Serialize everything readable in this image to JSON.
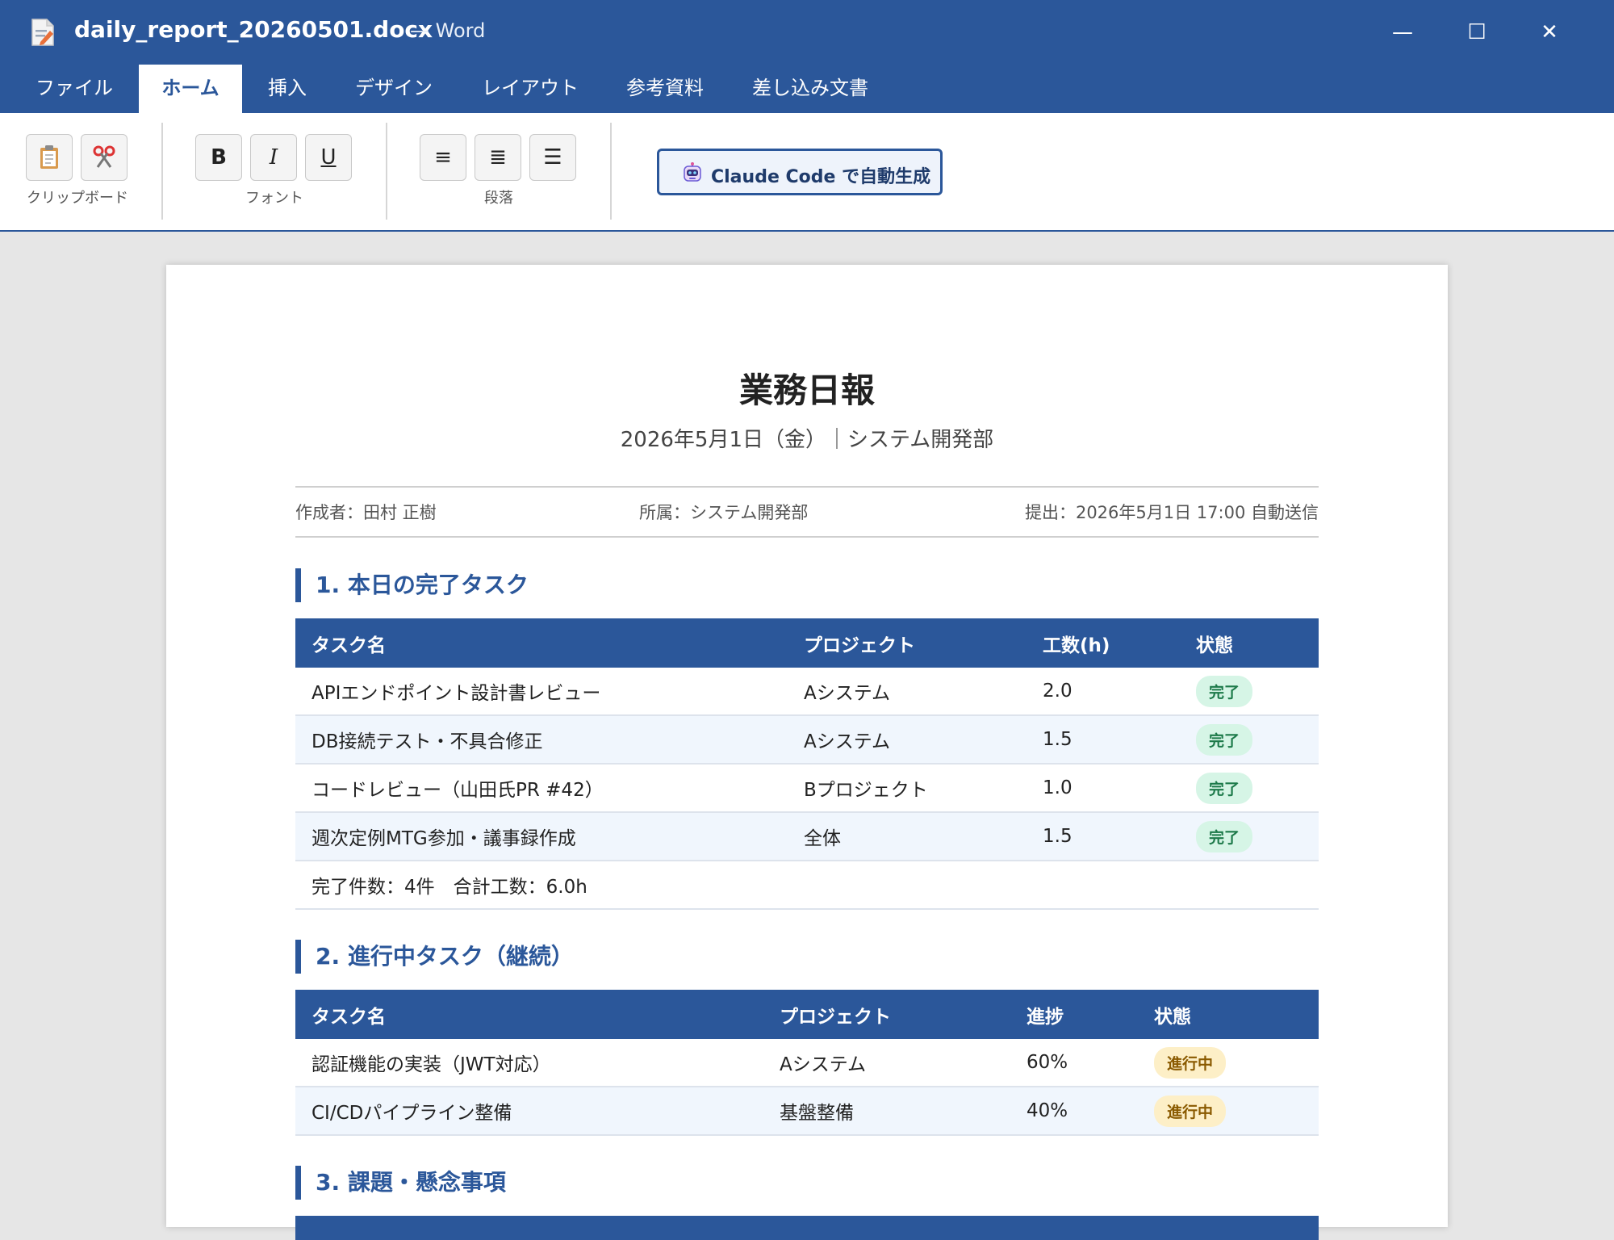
{
  "window": {
    "file_name": "daily_report_20260501.docx",
    "app_name": "— Word",
    "minimize": "—",
    "maximize": "☐",
    "close": "✕"
  },
  "tabs": [
    {
      "label": "ファイル",
      "active": false
    },
    {
      "label": "ホーム",
      "active": true
    },
    {
      "label": "挿入",
      "active": false
    },
    {
      "label": "デザイン",
      "active": false
    },
    {
      "label": "レイアウト",
      "active": false
    },
    {
      "label": "参考資料",
      "active": false
    },
    {
      "label": "差し込み文書",
      "active": false
    }
  ],
  "ribbon": {
    "clipboard": {
      "label": "クリップボード",
      "paste_icon": "clipboard-icon",
      "cut_icon": "scissors-icon"
    },
    "font": {
      "label": "フォント",
      "bold": "B",
      "italic": "I",
      "underline": "U"
    },
    "paragraph": {
      "label": "段落",
      "align_left": "≡",
      "align_center": "≣",
      "align_right": "☰"
    },
    "claude_button": "Claude Code で自動生成"
  },
  "document": {
    "title": "業務日報",
    "subtitle": "2026年5月1日（金）｜システム開発部",
    "meta": {
      "author": "作成者：田村 正樹",
      "department": "所属：システム開発部",
      "submitted": "提出：2026年5月1日 17:00 自動送信"
    },
    "section1": {
      "title": "1. 本日の完了タスク",
      "headers": [
        "タスク名",
        "プロジェクト",
        "工数(h)",
        "状態"
      ],
      "rows": [
        {
          "task": "APIエンドポイント設計書レビュー",
          "project": "Aシステム",
          "hours": "2.0",
          "status": "完了"
        },
        {
          "task": "DB接続テスト・不具合修正",
          "project": "Aシステム",
          "hours": "1.5",
          "status": "完了"
        },
        {
          "task": "コードレビュー（山田氏PR #42）",
          "project": "Bプロジェクト",
          "hours": "1.0",
          "status": "完了"
        },
        {
          "task": "週次定例MTG参加・議事録作成",
          "project": "全体",
          "hours": "1.5",
          "status": "完了"
        }
      ],
      "summary": "完了件数：4件　合計工数：6.0h"
    },
    "section2": {
      "title": "2. 進行中タスク（継続）",
      "headers": [
        "タスク名",
        "プロジェクト",
        "進捗",
        "状態"
      ],
      "rows": [
        {
          "task": "認証機能の実装（JWT対応）",
          "project": "Aシステム",
          "progress": "60%",
          "status": "進行中"
        },
        {
          "task": "CI/CDパイプライン整備",
          "project": "基盤整備",
          "progress": "40%",
          "status": "進行中"
        }
      ]
    },
    "section3": {
      "title": "3. 課題・懸念事項"
    }
  },
  "colors": {
    "brand": "#2b579a",
    "done_badge_bg": "#d6f5e6",
    "progress_badge_bg": "#fdefc7"
  }
}
